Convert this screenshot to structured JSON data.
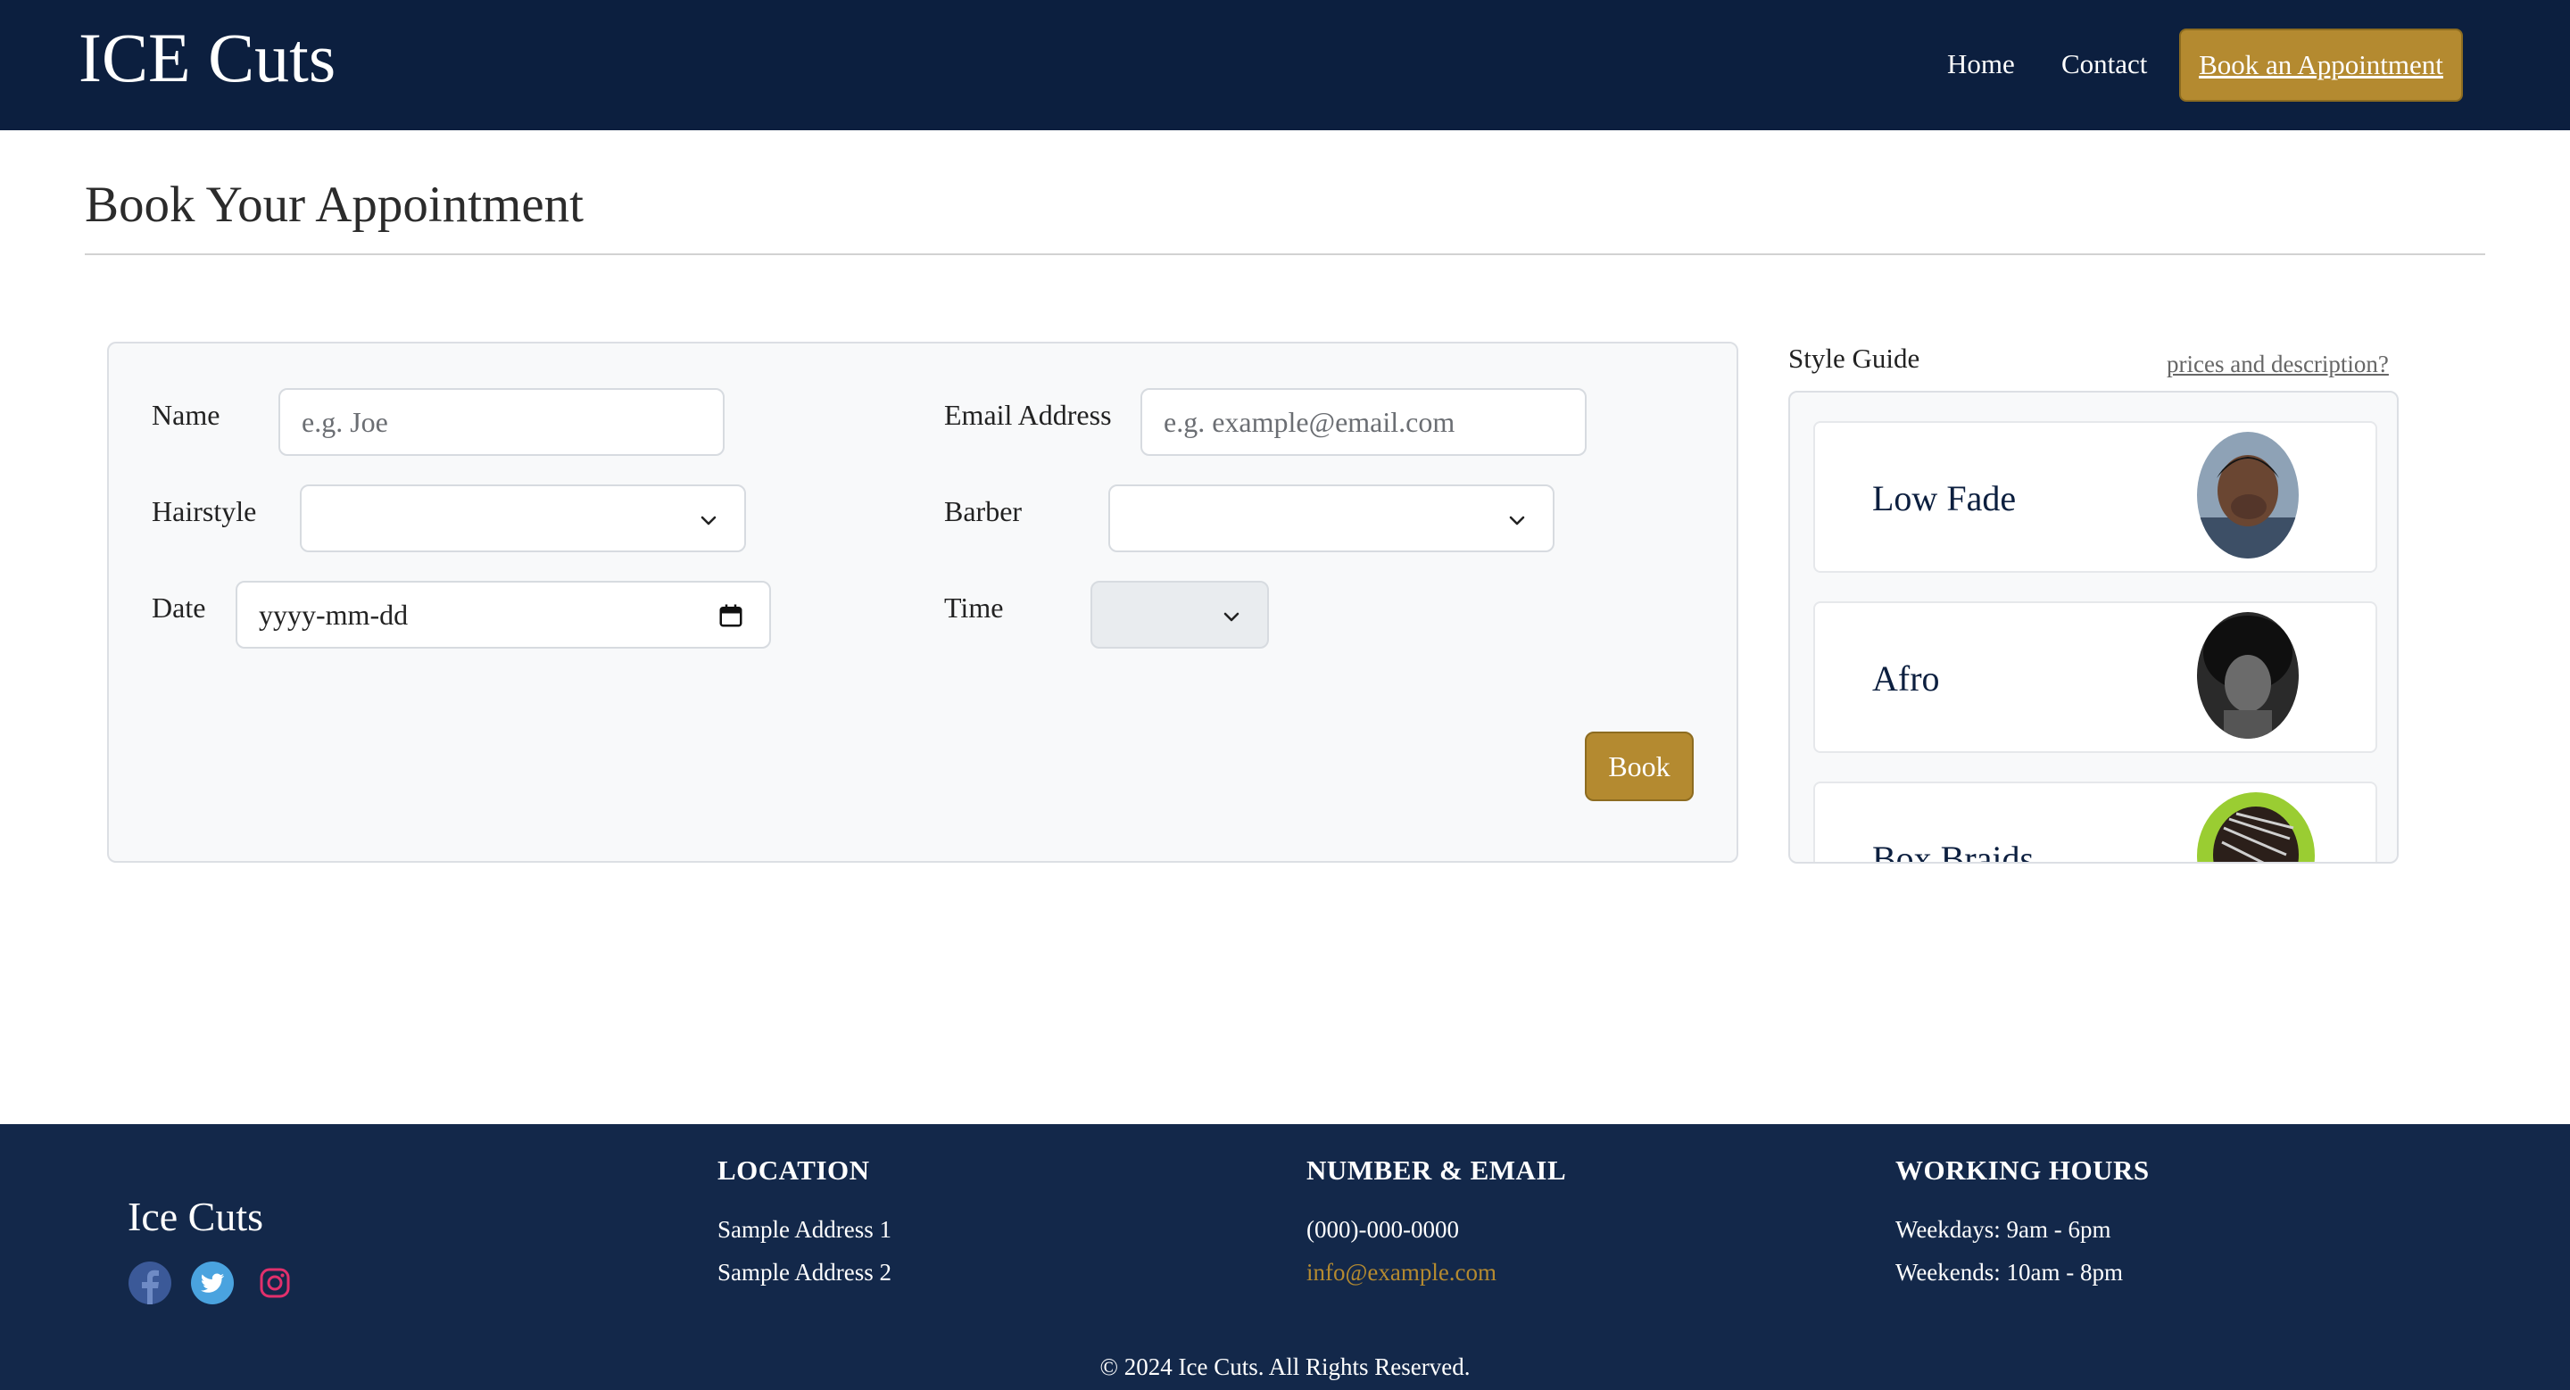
{
  "header": {
    "brand": "ICE Cuts",
    "nav": {
      "home": "Home",
      "contact": "Contact",
      "cta": "Book an Appointment"
    }
  },
  "page": {
    "title": "Book Your Appointment"
  },
  "form": {
    "name": {
      "label": "Name",
      "placeholder": "e.g. Joe",
      "value": ""
    },
    "email": {
      "label": "Email Address",
      "placeholder": "e.g. example@email.com",
      "value": ""
    },
    "hairstyle": {
      "label": "Hairstyle",
      "selected": ""
    },
    "barber": {
      "label": "Barber",
      "selected": ""
    },
    "date": {
      "label": "Date",
      "placeholder": "yyyy-mm-dd"
    },
    "time": {
      "label": "Time",
      "selected": ""
    },
    "submit_label": "Book"
  },
  "style_guide": {
    "title": "Style Guide",
    "link": "prices and description?",
    "items": [
      {
        "name": "Low Fade",
        "icon": "low-fade-photo"
      },
      {
        "name": "Afro",
        "icon": "afro-photo"
      },
      {
        "name": "Box Braids",
        "icon": "box-braids-photo"
      }
    ]
  },
  "footer": {
    "brand": "Ice Cuts",
    "location": {
      "heading": "LOCATION",
      "lines": [
        "Sample Address 1",
        "Sample Address 2"
      ]
    },
    "contact": {
      "heading": "NUMBER & EMAIL",
      "phone": "(000)-000-0000",
      "email": "info@example.com"
    },
    "hours": {
      "heading": "WORKING HOURS",
      "weekdays": "Weekdays: 9am - 6pm",
      "weekends": "Weekends: 10am - 8pm"
    },
    "copyright": "© 2024 Ice Cuts. All Rights Reserved.",
    "social": [
      "facebook-icon",
      "twitter-icon",
      "instagram-icon"
    ]
  },
  "colors": {
    "navy": "#0c1f3f",
    "footer_navy": "#13284a",
    "gold": "#b48a30"
  }
}
